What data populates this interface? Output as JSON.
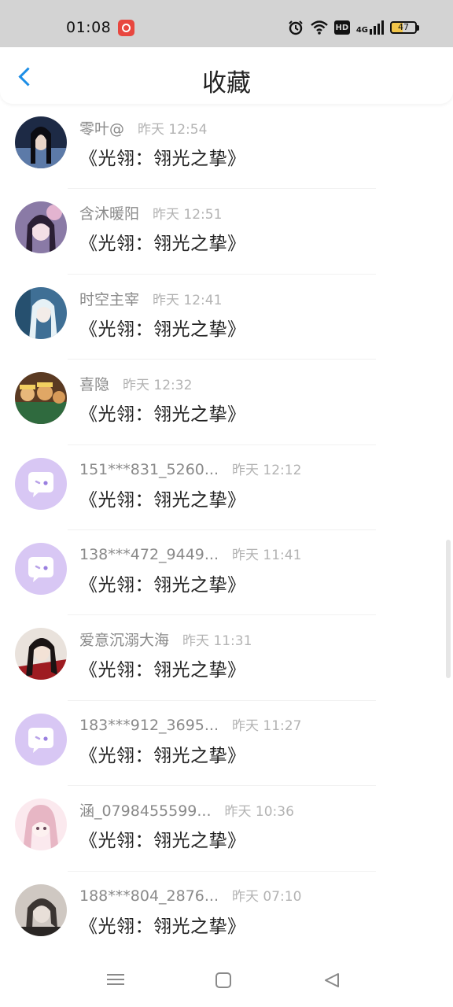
{
  "status_bar": {
    "time": "01:08",
    "battery": "47",
    "hd": "HD",
    "network": "4G"
  },
  "header": {
    "title": "收藏"
  },
  "items": [
    {
      "name": "零叶@",
      "time": "昨天 12:54",
      "content": "《光翎：翎光之挚》"
    },
    {
      "name": "含沐暖阳",
      "time": "昨天 12:51",
      "content": "《光翎：翎光之挚》"
    },
    {
      "name": "时空主宰",
      "time": "昨天 12:41",
      "content": "《光翎：翎光之挚》"
    },
    {
      "name": "喜隐",
      "time": "昨天 12:32",
      "content": "《光翎：翎光之挚》"
    },
    {
      "name": "151***831_5260...",
      "time": "昨天 12:12",
      "content": "《光翎：翎光之挚》"
    },
    {
      "name": "138***472_9449...",
      "time": "昨天 11:41",
      "content": "《光翎：翎光之挚》"
    },
    {
      "name": "爱意沉溺大海",
      "time": "昨天 11:31",
      "content": "《光翎：翎光之挚》"
    },
    {
      "name": "183***912_3695...",
      "time": "昨天 11:27",
      "content": "《光翎：翎光之挚》"
    },
    {
      "name": "涵_0798455599...",
      "time": "昨天 10:36",
      "content": "《光翎：翎光之挚》"
    },
    {
      "name": "188***804_2876...",
      "time": "昨天 07:10",
      "content": "《光翎：翎光之挚》"
    }
  ],
  "colors": {
    "accent": "#1d8ee6",
    "default_avatar": "#d8c7f4"
  }
}
